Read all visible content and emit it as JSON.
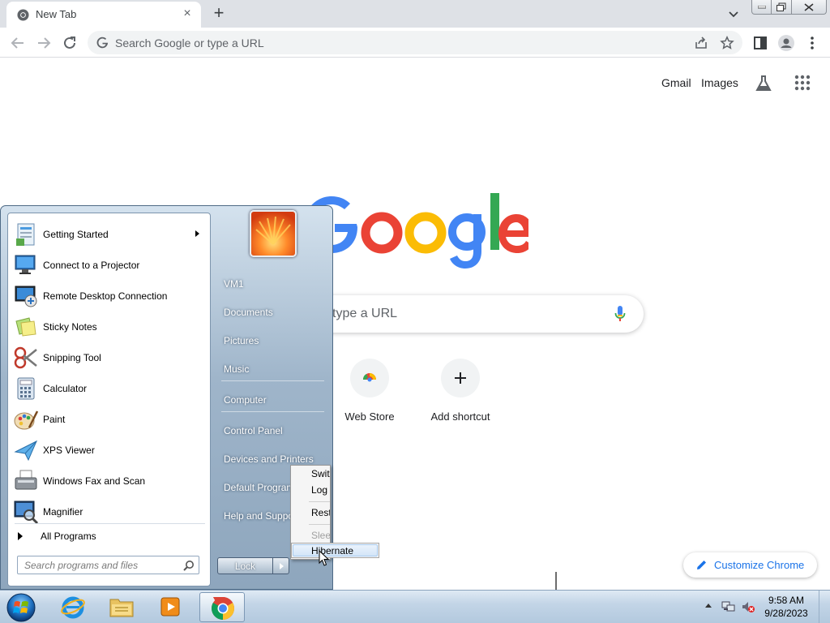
{
  "browser": {
    "tab": {
      "title": "New Tab"
    },
    "omnibox": {
      "placeholder": "Search Google or type a URL"
    }
  },
  "ntp": {
    "header_links": {
      "gmail": "Gmail",
      "images": "Images"
    },
    "search_placeholder": "type a URL",
    "shortcuts": [
      {
        "label": "Web Store",
        "icon": "web-store-icon"
      },
      {
        "label": "Add shortcut",
        "icon": "plus-icon"
      }
    ],
    "customize_label": "Customize Chrome"
  },
  "start_menu": {
    "programs": [
      {
        "label": "Getting Started",
        "icon": "getting-started-icon",
        "has_submenu": true
      },
      {
        "label": "Connect to a Projector",
        "icon": "projector-icon"
      },
      {
        "label": "Remote Desktop Connection",
        "icon": "remote-desktop-icon"
      },
      {
        "label": "Sticky Notes",
        "icon": "sticky-notes-icon"
      },
      {
        "label": "Snipping Tool",
        "icon": "snipping-tool-icon"
      },
      {
        "label": "Calculator",
        "icon": "calculator-icon"
      },
      {
        "label": "Paint",
        "icon": "paint-icon"
      },
      {
        "label": "XPS Viewer",
        "icon": "xps-viewer-icon"
      },
      {
        "label": "Windows Fax and Scan",
        "icon": "fax-scan-icon"
      },
      {
        "label": "Magnifier",
        "icon": "magnifier-icon"
      }
    ],
    "all_programs": "All Programs",
    "search_placeholder": "Search programs and files",
    "right_items": [
      {
        "label": "VM1"
      },
      {
        "label": "Documents"
      },
      {
        "label": "Pictures"
      },
      {
        "label": "Music"
      },
      {
        "label": "Computer"
      },
      {
        "label": "Control Panel"
      },
      {
        "label": "Devices and Printers"
      },
      {
        "label": "Default Programs"
      },
      {
        "label": "Help and Support"
      }
    ],
    "lock_label": "Lock",
    "power_menu": {
      "items": [
        {
          "label": "Switch user",
          "enabled": true
        },
        {
          "label": "Log off",
          "enabled": true
        },
        {
          "label": "Restart",
          "enabled": true
        },
        {
          "label": "Sleep",
          "enabled": false
        },
        {
          "label": "Hibernate",
          "enabled": true,
          "highlighted": true
        }
      ]
    }
  },
  "taskbar": {
    "apps": [
      "internet-explorer-icon",
      "windows-explorer-icon",
      "media-player-icon",
      "chrome-icon"
    ],
    "clock": {
      "time": "9:58 AM",
      "date": "9/28/2023"
    }
  }
}
